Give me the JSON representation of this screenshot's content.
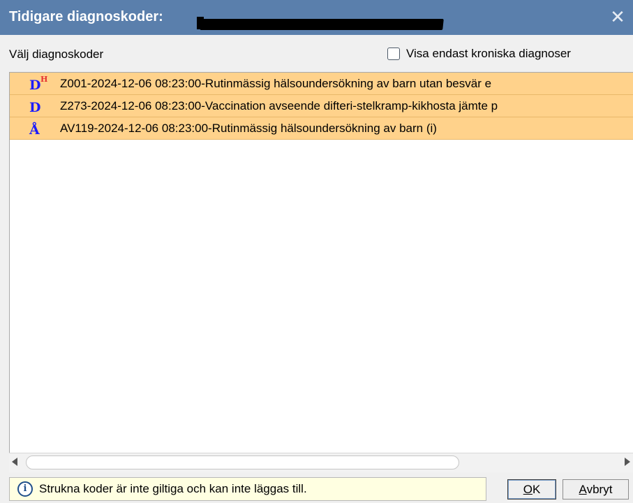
{
  "window": {
    "title": "Tidigare diagnoskoder:",
    "close_glyph": "✕"
  },
  "toolbar": {
    "choose_label": "Välj diagnoskoder",
    "chronic_checkbox_label": "Visa endast kroniska diagnoser",
    "chronic_checked": false
  },
  "diagnoses": [
    {
      "icon": "D",
      "icon_sup": "H",
      "text": "Z001-2024-12-06 08:23:00-Rutinmässig hälsoundersökning av barn utan besvär e"
    },
    {
      "icon": "D",
      "icon_sup": "",
      "text": "Z273-2024-12-06 08:23:00-Vaccination avseende difteri-stelkramp-kikhosta jämte p"
    },
    {
      "icon": "Å",
      "icon_sup": "",
      "text": "AV119-2024-12-06 08:23:00-Rutinmässig hälsoundersökning av barn (i)"
    }
  ],
  "footer": {
    "info_text": "Strukna koder är inte giltiga och kan inte läggas till.",
    "ok_label_ul": "O",
    "ok_label_rest": "K",
    "cancel_label_ul": "A",
    "cancel_label_rest": "vbryt"
  },
  "colors": {
    "titlebar": "#5a7fac",
    "row_highlight": "#ffd28b",
    "info_bg": "#ffffe1",
    "icon_blue": "#1c1cff",
    "icon_sup_red": "#e53030"
  }
}
